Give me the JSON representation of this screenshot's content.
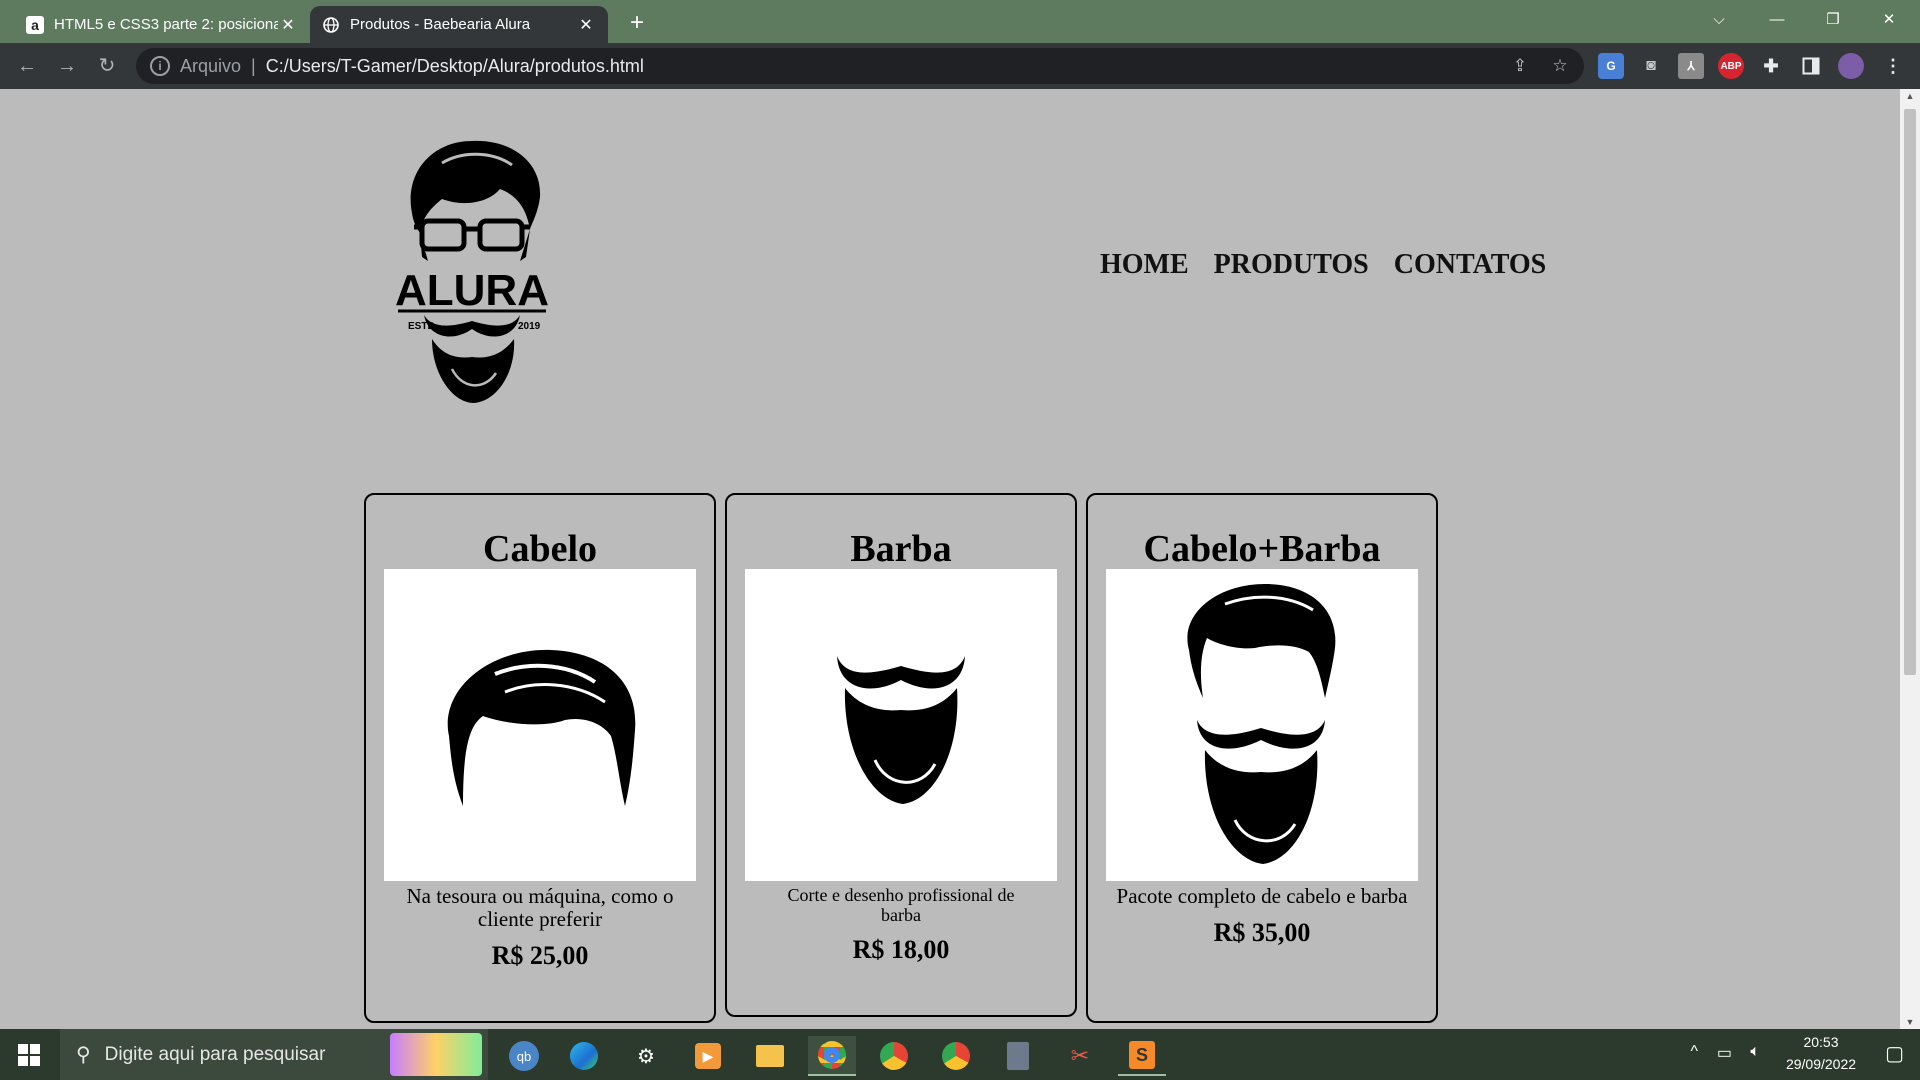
{
  "browser": {
    "tabs": [
      {
        "title": "HTML5 e CSS3 parte 2: posiciona",
        "favicon": "a"
      },
      {
        "title": "Produtos - Baebearia Alura",
        "favicon": "globe-icon"
      }
    ],
    "address": {
      "scheme": "Arquivo",
      "separator": "|",
      "url": "C:/Users/T-Gamer/Desktop/Alura/produtos.html"
    },
    "extensions": {
      "adblock": "ABP"
    }
  },
  "page": {
    "logo": {
      "brand": "ALURA",
      "left_tag": "ESTD",
      "right_tag": "2019"
    },
    "nav": [
      "HOME",
      "PRODUTOS",
      "CONTATOS"
    ],
    "products": [
      {
        "name": "Cabelo",
        "description": "Na tesoura ou máquina, como o cliente preferir",
        "price": "R$ 25,00"
      },
      {
        "name": "Barba",
        "description": "Corte e desenho profissional de barba",
        "price": "R$ 18,00"
      },
      {
        "name": "Cabelo+Barba",
        "description": "Pacote completo de cabelo e barba",
        "price": "R$ 35,00"
      }
    ]
  },
  "taskbar": {
    "search_placeholder": "Digite aqui para pesquisar",
    "time": "20:53",
    "date": "29/09/2022"
  },
  "colors": {
    "tabbar": "#5e7b5f",
    "toolbar": "#33373a",
    "page_bg": "#bbbbbb",
    "taskbar": "#2b3a2c"
  }
}
